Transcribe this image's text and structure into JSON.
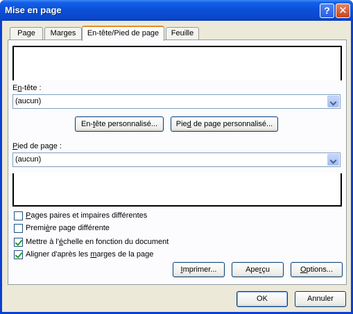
{
  "window": {
    "title": "Mise en page"
  },
  "titlebar": {
    "help_glyph": "?",
    "close_glyph": "✕"
  },
  "tabs": [
    {
      "label": "Page"
    },
    {
      "label": "Marges"
    },
    {
      "label": "En-tête/Pied de page",
      "active": true
    },
    {
      "label": "Feuille"
    }
  ],
  "header_section": {
    "label_pre": "E",
    "label_u": "n",
    "label_post": "-tête :",
    "value": "(aucun)"
  },
  "buttons": {
    "custom_header_u": "t",
    "custom_header_pre": "En-",
    "custom_header_post": "ête personnalisé...",
    "custom_footer_pre": "Pie",
    "custom_footer_u": "d",
    "custom_footer_post": " de page personnalisé...",
    "print_pre": "",
    "print_u": "I",
    "print_post": "mprimer...",
    "preview_pre": "Ape",
    "preview_u": "r",
    "preview_post": "çu",
    "options_pre": "",
    "options_u": "O",
    "options_post": "ptions...",
    "ok": "OK",
    "cancel": "Annuler"
  },
  "footer_section": {
    "label_pre": "",
    "label_u": "P",
    "label_post": "ied de page :",
    "value": "(aucun)"
  },
  "options": [
    {
      "pre": "",
      "u": "P",
      "post": "ages paires et impaires différentes",
      "checked": false
    },
    {
      "pre": "Premi",
      "u": "è",
      "post": "re page différente",
      "checked": false
    },
    {
      "pre": "Mettre à l'",
      "u": "é",
      "post": "chelle en fonction du document",
      "checked": true
    },
    {
      "pre": "Aligner d'après les ",
      "u": "m",
      "post": "arges de la page",
      "checked": true
    }
  ]
}
